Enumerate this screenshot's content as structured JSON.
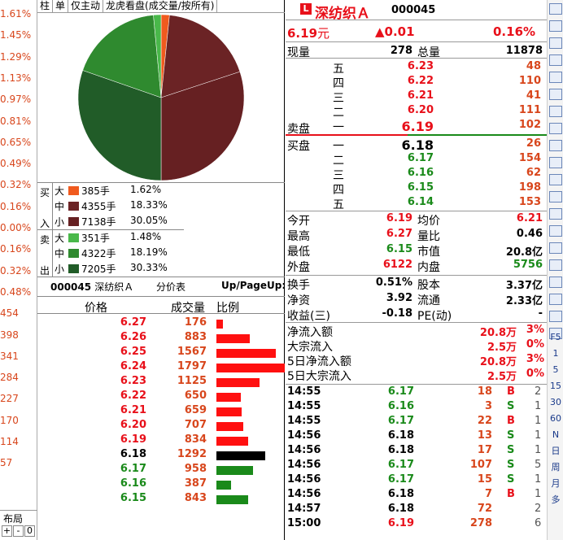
{
  "left_axis": {
    "values": [
      "1.61%",
      "1.45%",
      "1.29%",
      "1.13%",
      "0.97%",
      "0.81%",
      "0.65%",
      "0.49%",
      "0.32%",
      "0.16%",
      "0.00%",
      "0.16%",
      "0.32%",
      "0.48%",
      "454",
      "398",
      "341",
      "284",
      "227",
      "170",
      "114",
      "57"
    ],
    "bottom_label": "布局",
    "bottom_controls": [
      "+",
      "-",
      "0"
    ]
  },
  "tabs": [
    "柱",
    "单",
    "仅主动",
    "龙虎看盘(成交量/按所有)"
  ],
  "pie": {
    "slices": [
      {
        "label": "买大",
        "pct": 1.62,
        "color": "#f05a1e"
      },
      {
        "label": "买中",
        "pct": 18.33,
        "color": "#6b2325"
      },
      {
        "label": "买小",
        "pct": 30.05,
        "color": "#662022"
      },
      {
        "label": "卖大",
        "pct": 1.48,
        "color": "#49b84a"
      },
      {
        "label": "卖中",
        "pct": 18.19,
        "color": "#2f8a2f"
      },
      {
        "label": "卖小",
        "pct": 30.33,
        "color": "#215c28"
      }
    ]
  },
  "flow": {
    "buy_label": [
      "买",
      "入"
    ],
    "sell_label": [
      "卖",
      "出"
    ],
    "buy": [
      {
        "size": "大",
        "vol": "385手",
        "pct": "1.62%",
        "color": "#f05a1e"
      },
      {
        "size": "中",
        "vol": "4355手",
        "pct": "18.33%",
        "color": "#6b2325"
      },
      {
        "size": "小",
        "vol": "7138手",
        "pct": "30.05%",
        "color": "#662022"
      }
    ],
    "sell": [
      {
        "size": "大",
        "vol": "351手",
        "pct": "1.48%",
        "color": "#49b84a"
      },
      {
        "size": "中",
        "vol": "4322手",
        "pct": "18.19%",
        "color": "#2f8a2f"
      },
      {
        "size": "小",
        "vol": "7205手",
        "pct": "30.33%",
        "color": "#215c28"
      }
    ]
  },
  "pricetable": {
    "code": "000045",
    "name": "深纺织Ａ",
    "title": "分价表",
    "hint": "Up/PageUp:",
    "headers": [
      "价格",
      "成交量",
      "比例"
    ],
    "rows": [
      {
        "p": "6.27",
        "v": "176",
        "c": "red"
      },
      {
        "p": "6.26",
        "v": "883",
        "c": "red"
      },
      {
        "p": "6.25",
        "v": "1567",
        "c": "red"
      },
      {
        "p": "6.24",
        "v": "1797",
        "c": "red"
      },
      {
        "p": "6.23",
        "v": "1125",
        "c": "red"
      },
      {
        "p": "6.22",
        "v": "650",
        "c": "red"
      },
      {
        "p": "6.21",
        "v": "659",
        "c": "red"
      },
      {
        "p": "6.20",
        "v": "707",
        "c": "red"
      },
      {
        "p": "6.19",
        "v": "834",
        "c": "red"
      },
      {
        "p": "6.18",
        "v": "1292",
        "c": "black"
      },
      {
        "p": "6.17",
        "v": "958",
        "c": "green"
      },
      {
        "p": "6.16",
        "v": "387",
        "c": "green"
      },
      {
        "p": "6.15",
        "v": "843",
        "c": "green"
      }
    ]
  },
  "quote": {
    "badge": "L",
    "name": "深纺织Ａ",
    "code": "000045",
    "price": "6.19",
    "price_unit": "元",
    "change": "▲0.01",
    "change_pct": "0.16%",
    "vol_label": "现量",
    "vol": "278",
    "total_label": "总量",
    "total": "11878",
    "sell_label": "卖盘",
    "buy_label": "买盘",
    "asks": [
      {
        "n": "五",
        "p": "6.23",
        "v": "48"
      },
      {
        "n": "四",
        "p": "6.22",
        "v": "110"
      },
      {
        "n": "三",
        "p": "6.21",
        "v": "41"
      },
      {
        "n": "二",
        "p": "6.20",
        "v": "111"
      },
      {
        "n": "一",
        "p": "6.19",
        "v": "102"
      }
    ],
    "bids": [
      {
        "n": "一",
        "p": "6.18",
        "v": "26"
      },
      {
        "n": "二",
        "p": "6.17",
        "v": "154"
      },
      {
        "n": "三",
        "p": "6.16",
        "v": "62"
      },
      {
        "n": "四",
        "p": "6.15",
        "v": "198"
      },
      {
        "n": "五",
        "p": "6.14",
        "v": "153"
      }
    ],
    "stats": [
      [
        "今开",
        "6.19",
        "red",
        "均价",
        "6.21",
        "red"
      ],
      [
        "最高",
        "6.27",
        "red",
        "量比",
        "0.46",
        "black"
      ],
      [
        "最低",
        "6.15",
        "green",
        "市值",
        "20.8亿",
        "black"
      ],
      [
        "外盘",
        "6122",
        "red",
        "内盘",
        "5756",
        "green"
      ]
    ],
    "fin": [
      [
        "换手",
        "0.51%",
        "股本",
        "3.37亿"
      ],
      [
        "净资",
        "3.92",
        "流通",
        "2.33亿"
      ],
      [
        "收益(三)",
        "-0.18",
        "PE(动)",
        "-"
      ]
    ],
    "flows": [
      [
        "净流入额",
        "20.8万",
        "3%"
      ],
      [
        "大宗流入",
        "2.5万",
        "0%"
      ],
      [
        "5日净流入额",
        "20.8万",
        "3%"
      ],
      [
        "5日大宗流入",
        "2.5万",
        "0%"
      ]
    ],
    "ticks": [
      [
        "14:55",
        "6.17",
        "green",
        "18",
        "B",
        "red",
        "2"
      ],
      [
        "14:55",
        "6.16",
        "green",
        "3",
        "S",
        "green",
        "1"
      ],
      [
        "14:55",
        "6.17",
        "green",
        "22",
        "B",
        "red",
        "1"
      ],
      [
        "14:56",
        "6.18",
        "black",
        "13",
        "S",
        "green",
        "1"
      ],
      [
        "14:56",
        "6.18",
        "black",
        "17",
        "S",
        "green",
        "1"
      ],
      [
        "14:56",
        "6.17",
        "green",
        "107",
        "S",
        "green",
        "5"
      ],
      [
        "14:56",
        "6.17",
        "green",
        "15",
        "S",
        "green",
        "1"
      ],
      [
        "14:56",
        "6.18",
        "black",
        "7",
        "B",
        "red",
        "1"
      ],
      [
        "14:57",
        "6.18",
        "black",
        "72",
        "",
        "black",
        "2"
      ],
      [
        "15:00",
        "6.19",
        "red",
        "278",
        "",
        "black",
        "6"
      ]
    ]
  },
  "toolbar": {
    "icons": [
      "close-icon",
      "grid-icon",
      "add-icon",
      "line-chart-icon",
      "candle-icon",
      "table-icon",
      "list-icon",
      "f10-icon",
      "info-icon",
      "table2-icon",
      "f10b-icon",
      "fiz-icon",
      "fw-icon",
      "zoom-icon",
      "wave-icon",
      "chart2-icon",
      "chart3-icon",
      "pct-icon",
      "plus-icon",
      "pen-icon"
    ],
    "labels": [
      "Fio",
      "Fiz",
      "F5",
      "1",
      "5",
      "15",
      "30",
      "60",
      "N",
      "日",
      "周",
      "月",
      "多"
    ]
  }
}
